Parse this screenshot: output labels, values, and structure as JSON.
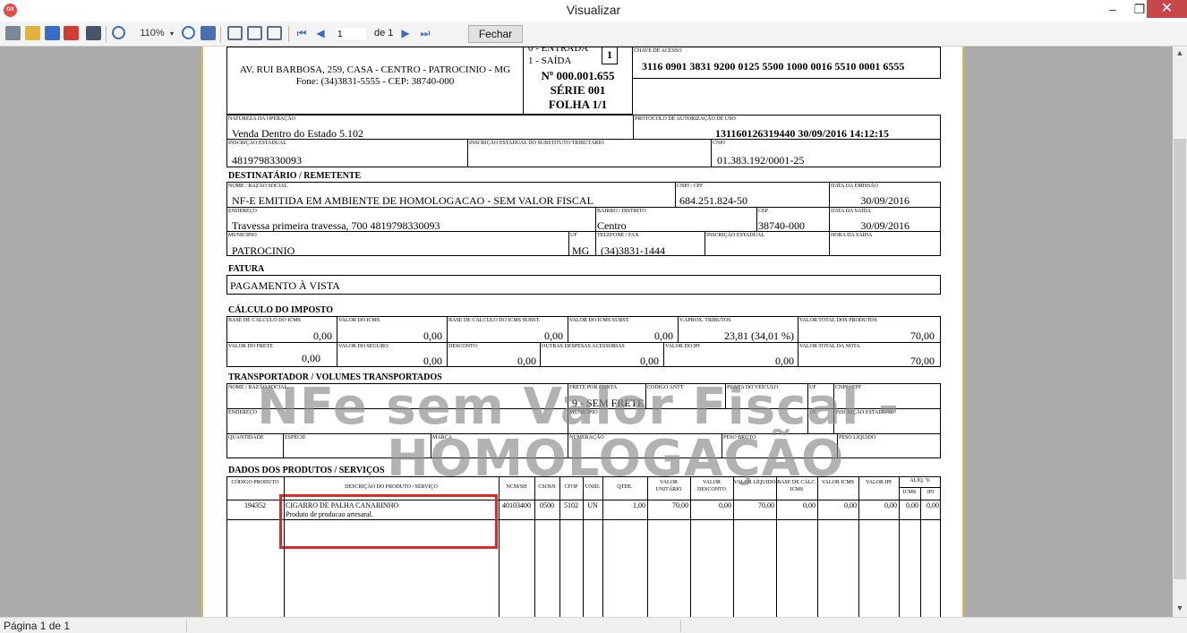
{
  "window": {
    "title": "Visualizar",
    "app_icon": "DX",
    "min": "–",
    "max": "❐",
    "close": "✕"
  },
  "toolbar": {
    "zoom": "110%",
    "page_current": "1",
    "page_of": "de 1",
    "close_label": "Fechar"
  },
  "status": {
    "text": "Página 1 de 1"
  },
  "doc": {
    "emit_address_line1": "AV. RUI BARBOSA, 259, CASA - CENTRO - PATROCINIO - MG",
    "emit_address_line2": "Fone: (34)3831-5555 - CEP: 38740-000",
    "entrada": "0 - ENTRADA",
    "saida": "1 - SAÍDA",
    "tipo": "1",
    "numero": "Nº 000.001.655",
    "serie": "SÉRIE 001",
    "folha": "FOLHA 1/1",
    "chave_label": "CHAVE DE ACESSO",
    "chave": "3116 0901 3831 9200 0125 5500 1000 0016 5510 0001 6555",
    "natureza_label": "NATUREZA DA OPERAÇÃO",
    "natureza": "Venda Dentro do Estado 5.102",
    "protocolo_label": "PROTOCOLO DE AUTORIZAÇÃO DE USO",
    "protocolo": "131160126319440 30/09/2016 14:12:15",
    "ie_label": "INSCRIÇÃO ESTADUAL",
    "ie": "4819798330093",
    "iest_label": "INSCRIÇÃO ESTADUAL DO SUBSTITUTO TRIBUTÁRIO",
    "cnpj_label": "CNPJ",
    "cnpj": "01.383.192/0001-25",
    "dest_title": "DESTINATÁRIO / REMETENTE",
    "nome_label": "NOME / RAZÃO SOCIAL",
    "nome": "NF-E EMITIDA EM AMBIENTE DE HOMOLOGACAO - SEM VALOR FISCAL",
    "cnpjcpf_label": "CNPJ / CPF",
    "cnpjcpf": "684.251.824-50",
    "emissao_label": "DATA DA EMISSÃO",
    "emissao": "30/09/2016",
    "endereco_label": "ENDEREÇO",
    "endereco": "Travessa primeira travessa, 700  4819798330093",
    "bairro_label": "BAIRRO / DISTRITO",
    "bairro": "Centro",
    "cep_label": "CEP",
    "cep": "38740-000",
    "saida_label": "DATA DA SAÍDA",
    "saida_data": "30/09/2016",
    "municipio_label": "MUNICÍPIO",
    "municipio": "PATROCINIO",
    "uf_label": "UF",
    "uf": "MG",
    "fone_label": "TELEFONE / FAX",
    "fone": "(34)3831-1444",
    "ie_dest_label": "INSCRIÇÃO ESTADUAL",
    "hora_label": "HORA DA SAÍDA",
    "fatura_title": "FATURA",
    "fatura": "PAGAMENTO À VISTA",
    "calc_title": "CÁLCULO DO IMPOSTO",
    "bc_icms_label": "BASE DE CÁLCULO DO ICMS",
    "bc_icms": "0,00",
    "v_icms_label": "VALOR DO ICMS",
    "v_icms": "0,00",
    "bc_st_label": "BASE DE CÁLCULO DO ICMS SUBST.",
    "bc_st": "0,00",
    "v_st_label": "VALOR DO ICMS SUBST.",
    "v_st": "0,00",
    "trib_label": "V.APROX. TRIBUTOS",
    "trib": "23,81 (34,01 %)",
    "v_prod_label": "VALOR TOTAL DOS PRODUTOS",
    "v_prod": "70,00",
    "frete_label": "VALOR DO FRETE",
    "frete": "0,00",
    "seguro_label": "VALOR DO SEGURO",
    "seguro": "0,00",
    "desconto_label": "DESCONTO",
    "desconto": "0,00",
    "outras_label": "OUTRAS DESPESAS ACESSÓRIAS",
    "outras": "0,00",
    "ipi_label": "VALOR DO IPI",
    "ipi": "0,00",
    "v_nota_label": "VALOR TOTAL DA NOTA",
    "v_nota": "70,00",
    "transp_title": "TRANSPORTADOR / VOLUMES TRANSPORTADOS",
    "t_nome_label": "NOME / RAZÃO SOCIAL",
    "t_frete_label": "FRETE POR CONTA",
    "t_frete": "9 - SEM FRETE",
    "t_antt_label": "CÓDIGO ANTT",
    "t_placa_label": "PLACA DO VEÍCULO",
    "t_uf_label": "UF",
    "t_cnpj_label": "CNPJ / CPF",
    "t_end_label": "ENDEREÇO",
    "t_mun_label": "MUNICÍPIO",
    "t_uf2_label": "UF",
    "t_ie_label": "INSCRIÇÃO ESTADUAL",
    "t_qtd_label": "QUANTIDADE",
    "t_esp_label": "ESPÉCIE",
    "t_marca_label": "MARCA",
    "t_num_label": "NUMERAÇÃO",
    "t_pb_label": "PESO BRUTO",
    "t_pl_label": "PESO LÍQUIDO",
    "prod_title": "DADOS DOS PRODUTOS / SERVIÇOS",
    "watermark_line1": "NFe sem Valor Fiscal -",
    "watermark_line2": "HOMOLOGAÇÃO",
    "col_codigo": "CÓDIGO PRODUTO",
    "col_desc": "DESCRIÇÃO DO PRODUTO / SERVIÇO",
    "col_ncm": "NCM/SH",
    "col_csosn": "CSOSN",
    "col_cfop": "CFOP",
    "col_unid": "UNID.",
    "col_qtde": "QTDE.",
    "col_vunit": "VALOR UNITÁRIO",
    "col_vdesc": "VALOR DESCONTO",
    "col_vliq": "VALOR LÍQUIDO",
    "col_bc": "BASE DE CÁLC. ICMS",
    "col_vicms": "VALOR ICMS",
    "col_vipi": "VALOR IPI",
    "col_aliq": "ALÍQ. %",
    "col_aicms": "ICMS",
    "col_aipi": "IPI",
    "item": {
      "codigo": "194352",
      "desc": "CIGARRO DE PALHA CANARINHO",
      "desc2": "Produto de producao artesaral.",
      "ncm": "40103400",
      "csosn": "0500",
      "cfop": "5102",
      "unid": "UN",
      "qtde": "1,00",
      "vunit": "70,00",
      "vdesc": "0,00",
      "vliq": "70,00",
      "bc": "0,00",
      "vicms": "0,00",
      "vipi": "0,00",
      "aicms": "0,00",
      "aipi": "0,00"
    }
  }
}
